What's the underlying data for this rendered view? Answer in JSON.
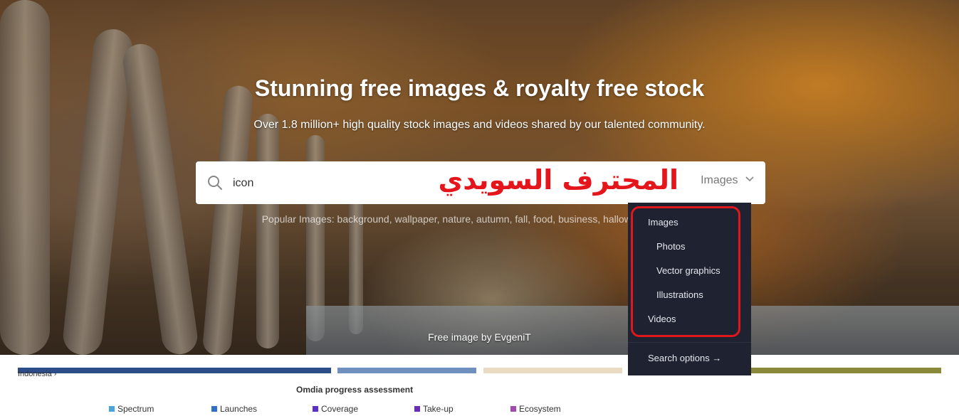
{
  "hero": {
    "title": "Stunning free images & royalty free stock",
    "subtitle": "Over 1.8 million+ high quality stock images and videos shared by our talented community.",
    "credit": "Free image by EvgeniT"
  },
  "search": {
    "value": "icon",
    "type_selected": "Images",
    "watermark": "المحترف السويدي"
  },
  "popular": {
    "text": "Popular Images: background, wallpaper, nature, autumn, fall, food, business, halloween, office, dog"
  },
  "dropdown": {
    "images": "Images",
    "photos": "Photos",
    "vector": "Vector graphics",
    "illustrations": "Illustrations",
    "videos": "Videos",
    "options": "Search options →"
  },
  "bottom": {
    "thumb_label": "Indonesia ›",
    "omdia_title": "Omdia progress assessment",
    "legend": [
      {
        "label": "Spectrum",
        "color": "#4aa3df"
      },
      {
        "label": "Launches",
        "color": "#2f6fc9"
      },
      {
        "label": "Coverage",
        "color": "#5b2fc9"
      },
      {
        "label": "Take-up",
        "color": "#6a2fb0"
      },
      {
        "label": "Ecosystem",
        "color": "#a24ab0"
      }
    ]
  }
}
